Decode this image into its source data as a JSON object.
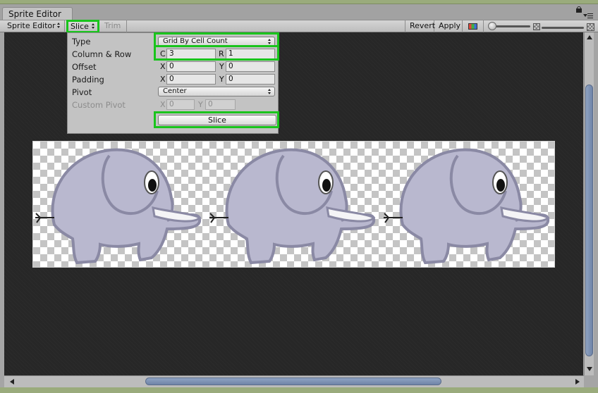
{
  "window": {
    "tab_title": "Sprite Editor"
  },
  "toolbar": {
    "mode_label": "Sprite Editor",
    "slice_label": "Slice",
    "trim_label": "Trim",
    "revert_label": "Revert",
    "apply_label": "Apply"
  },
  "slice_panel": {
    "type_label": "Type",
    "type_value": "Grid By Cell Count",
    "column_row_label": "Column & Row",
    "column_axis": "C",
    "column_value": "3",
    "row_axis": "R",
    "row_value": "1",
    "offset_label": "Offset",
    "offset_x_axis": "X",
    "offset_x": "0",
    "offset_y_axis": "Y",
    "offset_y": "0",
    "padding_label": "Padding",
    "padding_x_axis": "X",
    "padding_x": "0",
    "padding_y_axis": "Y",
    "padding_y": "0",
    "pivot_label": "Pivot",
    "pivot_value": "Center",
    "custom_pivot_label": "Custom Pivot",
    "custom_pivot_x_axis": "X",
    "custom_pivot_x": "0",
    "custom_pivot_y_axis": "Y",
    "custom_pivot_y": "0",
    "slice_button_label": "Slice"
  },
  "colors": {
    "highlight": "#19c41c",
    "canvas_bg": "#272727",
    "panel_bg": "#c3c3c3",
    "scrollbar_thumb": "#7f93b6",
    "elephant_body": "#b9b8cf",
    "elephant_outline": "#8a89a4"
  },
  "icons": {
    "lock": "lock-icon",
    "window_menu": "window-menu-icon",
    "rgb_toggle": "rgb-channels-icon",
    "mip_low": "mip-low-icon",
    "mip_high": "mip-high-icon"
  },
  "sprite_sheet": {
    "sprite_count": 3
  }
}
